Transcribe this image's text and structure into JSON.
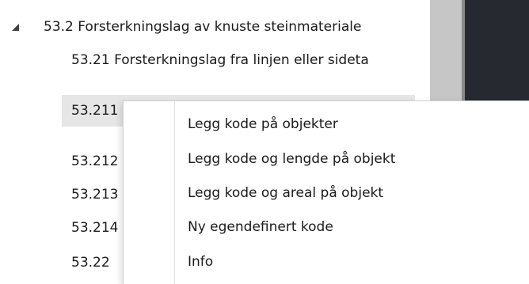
{
  "tree": {
    "parent": {
      "label": "53.2 Forsterkningslag av knuste steinmateriale"
    },
    "children": [
      {
        "label": "53.21 Forsterkningslag fra linjen eller sideta"
      },
      {
        "label": "53.211"
      },
      {
        "label": "53.212"
      },
      {
        "label": "53.213"
      },
      {
        "label": "53.214"
      },
      {
        "label": "53.22"
      }
    ]
  },
  "context_menu": {
    "items": [
      {
        "label": "Legg kode på objekter"
      },
      {
        "label": "Legg kode og lengde på objekt"
      },
      {
        "label": "Legg kode og areal på objekt"
      },
      {
        "label": "Ny egendefinert kode"
      },
      {
        "label": "Info"
      }
    ]
  }
}
